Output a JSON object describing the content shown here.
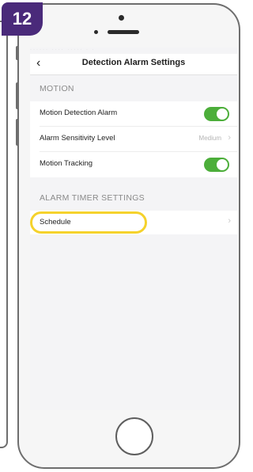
{
  "step_badge": "12",
  "header": {
    "title": "Detection Alarm Settings",
    "back_icon": "chevron-left-icon",
    "status_faint": "······ ····  ····· · ·"
  },
  "sections": {
    "motion_header": "MOTION",
    "timer_header": "ALARM TIMER SETTINGS"
  },
  "rows": {
    "motion_detection_alarm": {
      "label": "Motion Detection Alarm",
      "enabled": true
    },
    "alarm_sensitivity_level": {
      "label": "Alarm Sensitivity Level",
      "value": "Medium"
    },
    "motion_tracking": {
      "label": "Motion Tracking",
      "enabled": true
    },
    "schedule": {
      "label": "Schedule"
    }
  },
  "colors": {
    "badge": "#4a2a7a",
    "toggle_on": "#4cae3a",
    "highlight": "#f5d22c"
  }
}
